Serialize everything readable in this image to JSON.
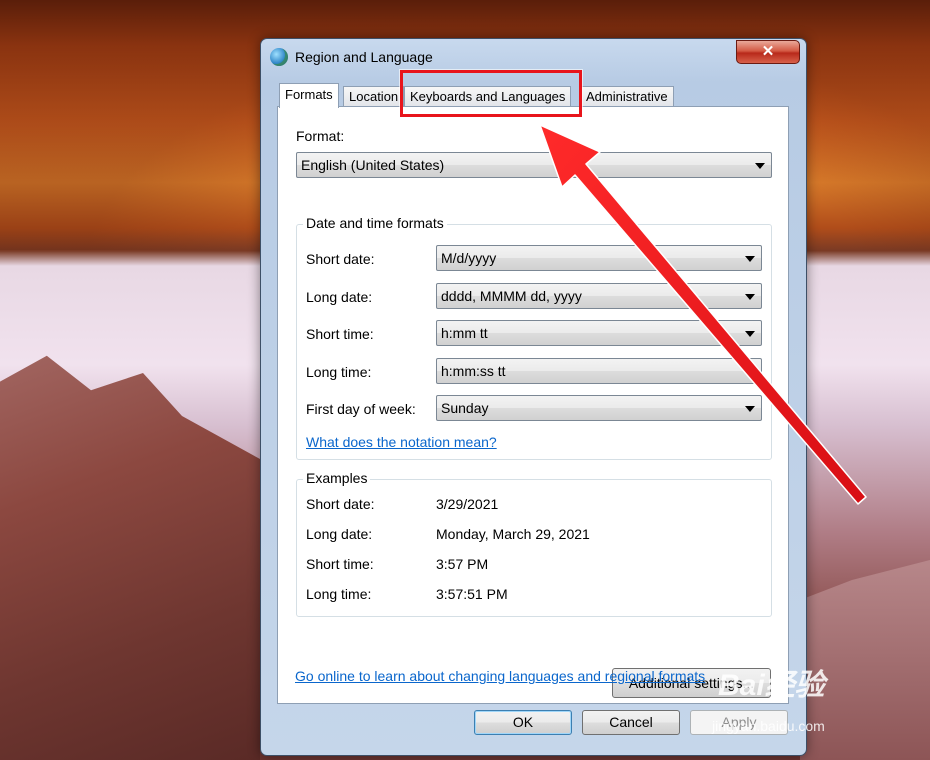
{
  "window": {
    "title": "Region and Language",
    "close_glyph": "✕"
  },
  "tabs": [
    {
      "label": "Formats",
      "active": true
    },
    {
      "label": "Location",
      "active": false
    },
    {
      "label": "Keyboards and Languages",
      "active": false
    },
    {
      "label": "Administrative",
      "active": false
    }
  ],
  "formats": {
    "format_label": "Format:",
    "format_value": "English (United States)",
    "datetime_group_title": "Date and time formats",
    "short_date_label": "Short date:",
    "short_date_value": "M/d/yyyy",
    "long_date_label": "Long date:",
    "long_date_value": "dddd, MMMM dd, yyyy",
    "short_time_label": "Short time:",
    "short_time_value": "h:mm tt",
    "long_time_label": "Long time:",
    "long_time_value": "h:mm:ss tt",
    "first_day_label": "First day of week:",
    "first_day_value": "Sunday",
    "notation_link": "What does the notation mean?"
  },
  "examples": {
    "group_title": "Examples",
    "rows": [
      {
        "label": "Short date:",
        "value": "3/29/2021"
      },
      {
        "label": "Long date:",
        "value": "Monday, March 29, 2021"
      },
      {
        "label": "Short time:",
        "value": "3:57 PM"
      },
      {
        "label": "Long time:",
        "value": "3:57:51 PM"
      }
    ]
  },
  "additional_settings_button": "Additional settings...",
  "online_link": "Go online to learn about changing languages and regional formats",
  "buttons": {
    "ok": "OK",
    "cancel": "Cancel",
    "apply": "Apply"
  },
  "annotation": {
    "color": "#e8141b"
  },
  "watermark": {
    "brand": "Bai经验",
    "url": "jingyan.baidu.com"
  }
}
